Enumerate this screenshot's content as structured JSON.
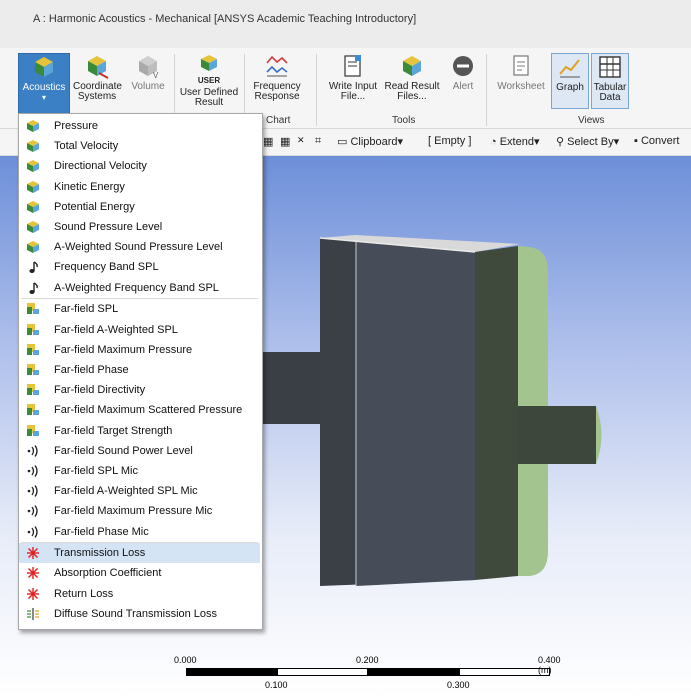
{
  "window": {
    "title": "A : Harmonic Acoustics - Mechanical [ANSYS Academic Teaching Introductory]"
  },
  "ribbon": {
    "acoustics": "Acoustics",
    "coordinate_systems_1": "Coordinate",
    "coordinate_systems_2": "Systems",
    "volume": "Volume",
    "user_defined_1": "User Defined",
    "user_defined_2": "Result",
    "user_badge": "USER",
    "frequency_response_1": "Frequency",
    "frequency_response_2": "Response",
    "chart_label": "Chart",
    "write_input_1": "Write Input",
    "write_input_2": "File...",
    "read_result_1": "Read Result",
    "read_result_2": "Files...",
    "alert": "Alert",
    "tools_label": "Tools",
    "worksheet": "Worksheet",
    "graph": "Graph",
    "tabular_1": "Tabular",
    "tabular_2": "Data",
    "views_label": "Views"
  },
  "toolbar": {
    "clipboard": "Clipboard",
    "empty": "[ Empty ]",
    "extend": "Extend",
    "select_by": "Select By",
    "convert": "Convert"
  },
  "scale": {
    "l0": "0.000",
    "l100": "0.100",
    "l200": "0.200",
    "l300": "0.300",
    "l400": "0.400 (m)"
  },
  "menu": {
    "items": [
      {
        "label": "Pressure",
        "icon": "acoustic-result-icon"
      },
      {
        "label": "Total Velocity",
        "icon": "acoustic-result-icon"
      },
      {
        "label": "Directional Velocity",
        "icon": "acoustic-result-icon"
      },
      {
        "label": "Kinetic Energy",
        "icon": "acoustic-result-icon"
      },
      {
        "label": "Potential Energy",
        "icon": "acoustic-result-icon"
      },
      {
        "label": "Sound Pressure Level",
        "icon": "acoustic-result-icon"
      },
      {
        "label": "A-Weighted Sound Pressure Level",
        "icon": "acoustic-result-icon"
      },
      {
        "label": "Frequency Band SPL",
        "icon": "music-note-icon"
      },
      {
        "label": "A-Weighted Frequency Band SPL",
        "icon": "music-note-icon"
      },
      {
        "label": "Far-field SPL",
        "icon": "far-field-icon"
      },
      {
        "label": "Far-field A-Weighted SPL",
        "icon": "far-field-icon"
      },
      {
        "label": "Far-field Maximum Pressure",
        "icon": "far-field-icon"
      },
      {
        "label": "Far-field Phase",
        "icon": "far-field-icon"
      },
      {
        "label": "Far-field Directivity",
        "icon": "far-field-icon"
      },
      {
        "label": "Far-field Maximum Scattered Pressure",
        "icon": "far-field-icon"
      },
      {
        "label": "Far-field Target Strength",
        "icon": "far-field-icon"
      },
      {
        "label": "Far-field Sound Power Level",
        "icon": "sound-wave-icon"
      },
      {
        "label": "Far-field SPL Mic",
        "icon": "sound-wave-icon"
      },
      {
        "label": "Far-field A-Weighted SPL Mic",
        "icon": "sound-wave-icon"
      },
      {
        "label": "Far-field Maximum Pressure Mic",
        "icon": "sound-wave-icon"
      },
      {
        "label": "Far-field Phase Mic",
        "icon": "sound-wave-icon"
      },
      {
        "label": "Transmission Loss",
        "icon": "red-star-icon"
      },
      {
        "label": "Absorption Coefficient",
        "icon": "red-star-icon"
      },
      {
        "label": "Return Loss",
        "icon": "red-star-icon"
      },
      {
        "label": "Diffuse Sound Transmission Loss",
        "icon": "diffuse-tl-icon"
      }
    ],
    "highlighted": "Transmission Loss"
  }
}
